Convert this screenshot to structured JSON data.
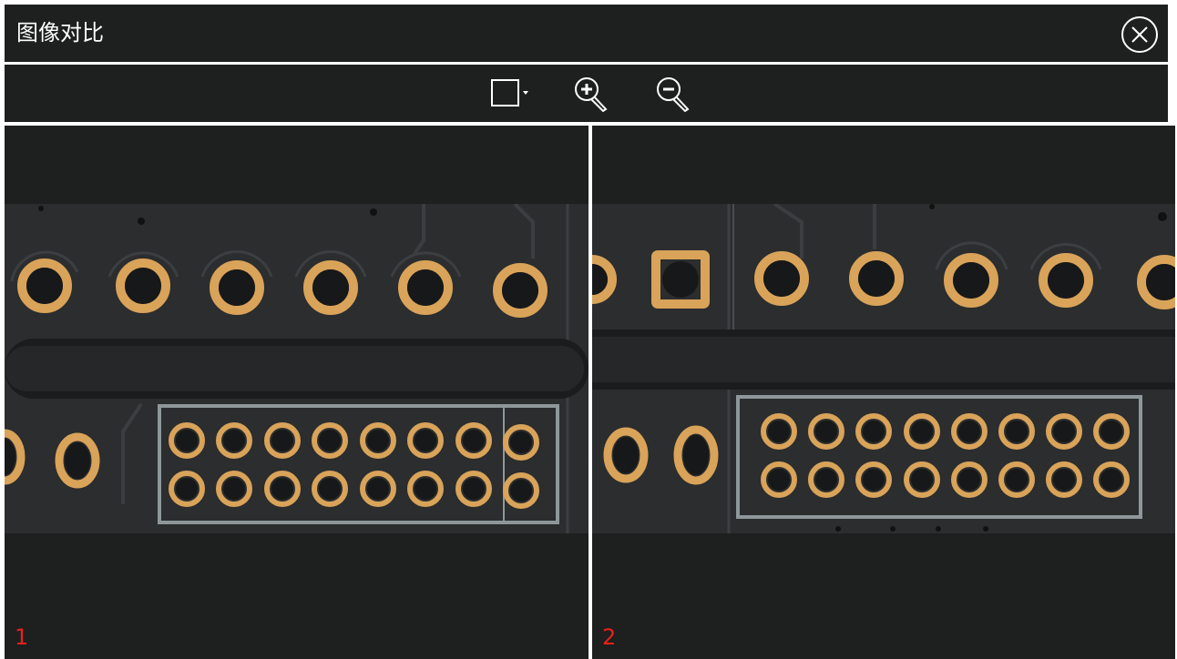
{
  "window": {
    "title": "图像对比",
    "close_icon": "circle-x-icon"
  },
  "toolbar": {
    "tools": [
      {
        "name": "rectangle-select-dropdown",
        "icon": "rectangle-icon"
      },
      {
        "name": "zoom-in",
        "icon": "zoom-in-icon"
      },
      {
        "name": "zoom-out",
        "icon": "zoom-out-icon"
      }
    ]
  },
  "panes": [
    {
      "index": "1",
      "image": "pcb-photo-left"
    },
    {
      "index": "2",
      "image": "pcb-photo-right"
    }
  ],
  "colors": {
    "background": "#1e1f1f",
    "divider": "#ffffff",
    "text": "#ffffff",
    "index_label": "#e8221b",
    "pad_copper": "#d9a35a",
    "board": "#2b2d2e"
  }
}
